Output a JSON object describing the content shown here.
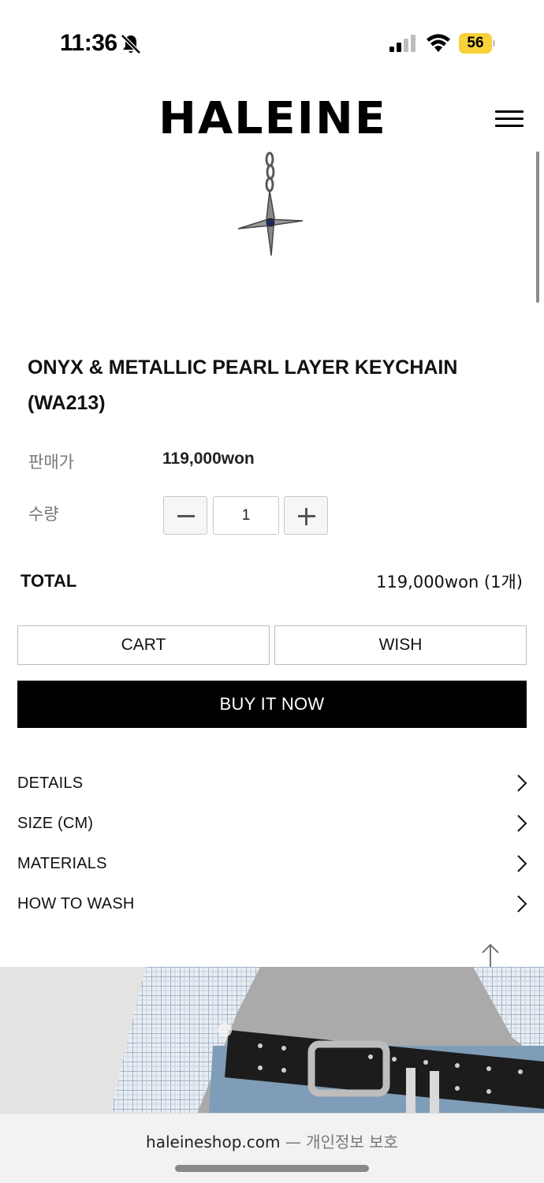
{
  "status_bar": {
    "time": "11:36",
    "battery": "56",
    "icons": [
      "bell-slash-icon",
      "signal-icon",
      "wifi-icon",
      "battery-icon"
    ]
  },
  "header": {
    "logo": "HALEINE",
    "menu_icon": "hamburger-menu-icon"
  },
  "product": {
    "title": "ONYX & METALLIC PEARL LAYER KEYCHAIN (WA213)",
    "price_label": "판매가",
    "price": "119,000won",
    "quantity_label": "수량",
    "quantity": "1",
    "total_label": "TOTAL",
    "total_value": "119,000won (1개)"
  },
  "actions": {
    "cart": "CART",
    "wish": "WISH",
    "buy_now": "BUY IT NOW"
  },
  "accordion": [
    {
      "label": "DETAILS"
    },
    {
      "label": "SIZE (CM)"
    },
    {
      "label": "MATERIALS"
    },
    {
      "label": "HOW TO WASH"
    }
  ],
  "browser": {
    "domain": "haleineshop.com",
    "suffix": "— 개인정보 보호"
  },
  "colors": {
    "primary_button": "#000000",
    "battery": "#f7d13a",
    "muted_text": "#777777"
  }
}
